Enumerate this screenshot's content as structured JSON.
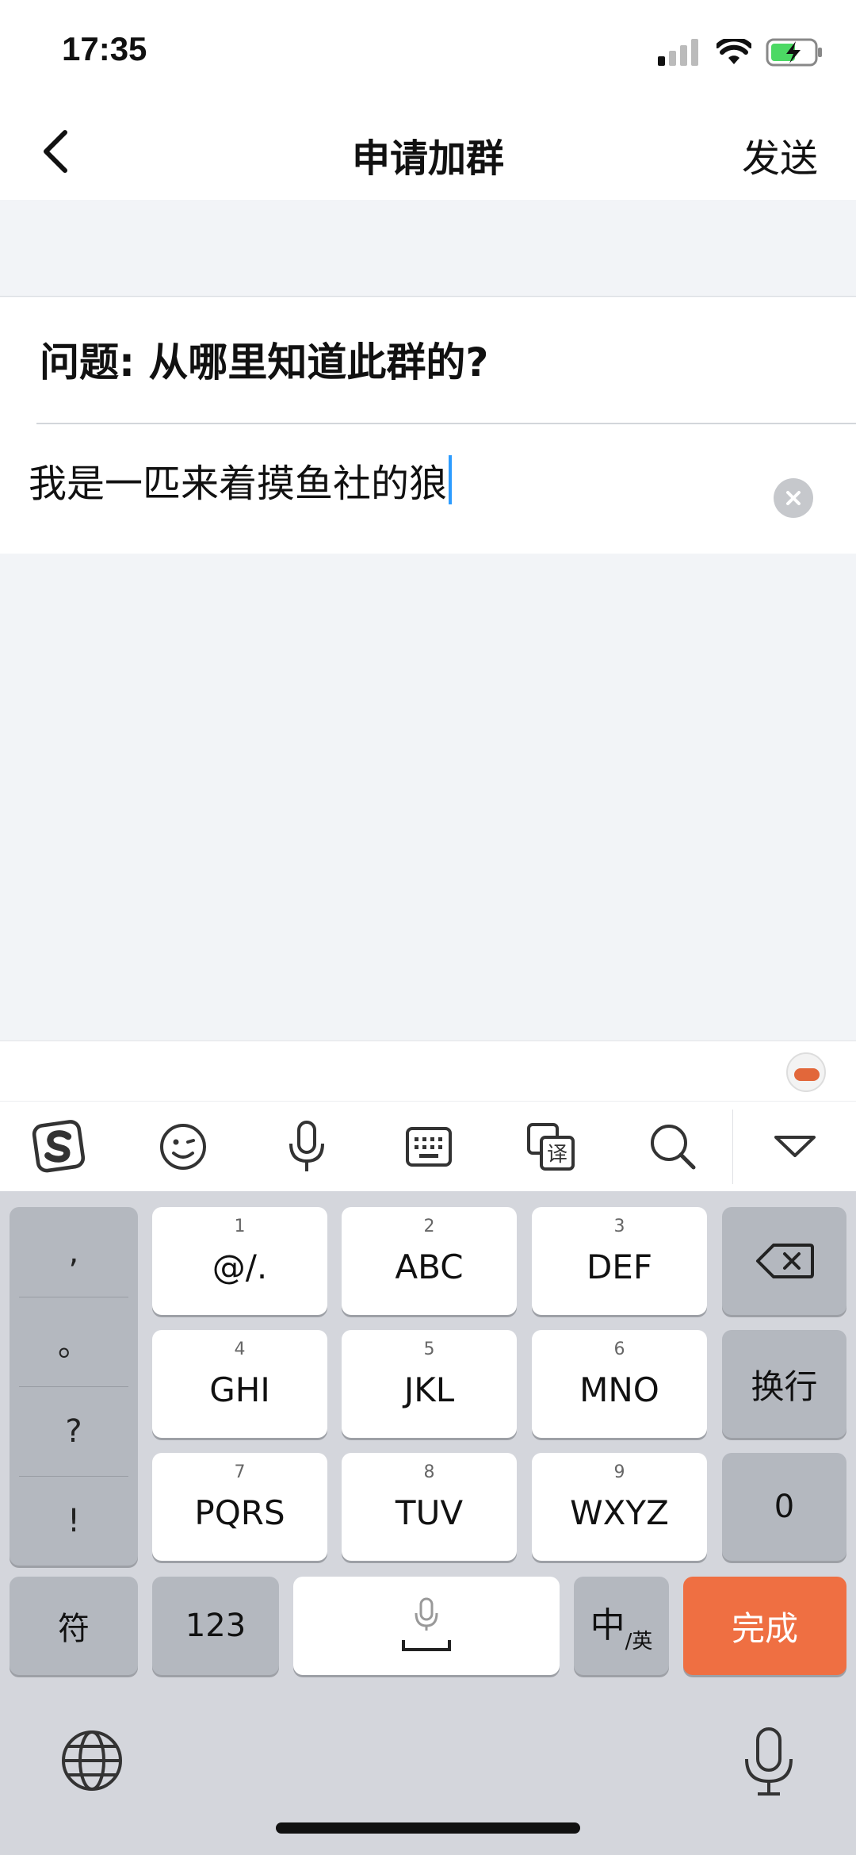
{
  "status_bar": {
    "time": "17:35"
  },
  "nav": {
    "title": "申请加群",
    "send_label": "发送"
  },
  "question": {
    "text": "问题: 从哪里知道此群的?",
    "answer": "我是一匹来着摸鱼社的狼"
  },
  "toolbar": {
    "icons": [
      "sogou-logo-icon",
      "emoji-icon",
      "voice-icon",
      "keyboard-icon",
      "translate-icon",
      "search-icon",
      "collapse-icon"
    ],
    "translate_char": "译"
  },
  "keyboard": {
    "punctuation": [
      ",",
      "。",
      "?",
      "!"
    ],
    "keys": [
      {
        "num": "1",
        "label": "@/."
      },
      {
        "num": "2",
        "label": "ABC"
      },
      {
        "num": "3",
        "label": "DEF"
      },
      {
        "num": "4",
        "label": "GHI"
      },
      {
        "num": "5",
        "label": "JKL"
      },
      {
        "num": "6",
        "label": "MNO"
      },
      {
        "num": "7",
        "label": "PQRS"
      },
      {
        "num": "8",
        "label": "TUV"
      },
      {
        "num": "9",
        "label": "WXYZ"
      }
    ],
    "newline_label": "换行",
    "zero_label": "0",
    "symbol_label": "符",
    "numeric_label": "123",
    "lang_label_main": "中",
    "lang_label_sub": "/英",
    "done_label": "完成",
    "accent_color": "#ef6f42"
  }
}
